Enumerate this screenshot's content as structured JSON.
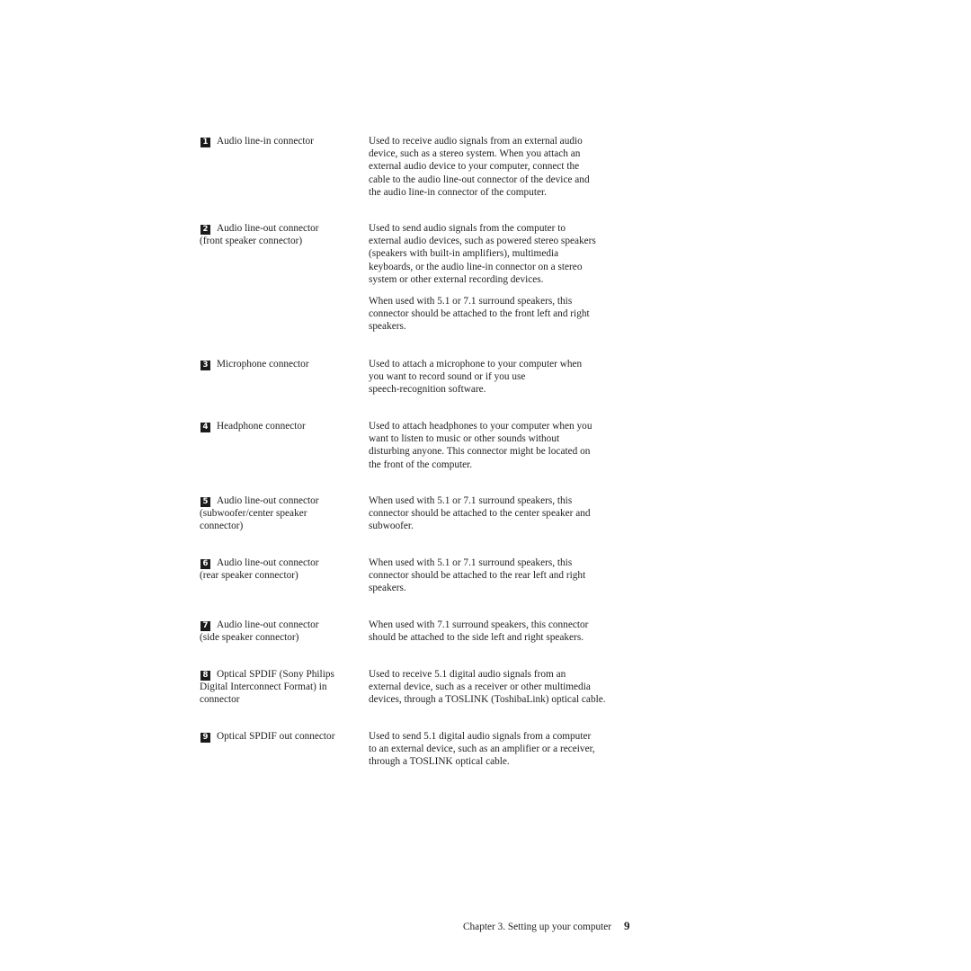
{
  "entries": [
    {
      "number": "1",
      "term": "Audio line-in connector",
      "description": [
        "Used to receive audio signals from an external audio\ndevice, such as a stereo system. When you attach an\nexternal audio device to your computer, connect the\ncable to the audio line-out connector of the device and\nthe audio line-in connector of the computer."
      ]
    },
    {
      "number": "2",
      "term": "Audio line-out connector\n(front speaker connector)",
      "description": [
        "Used to send audio signals from the computer to\nexternal audio devices, such as powered stereo speakers\n(speakers with built-in amplifiers), multimedia\nkeyboards, or the audio line-in connector on a stereo\nsystem or other external recording devices.",
        "When used with 5.1 or 7.1 surround speakers, this\nconnector should be attached to the front left and right\nspeakers."
      ]
    },
    {
      "number": "3",
      "term": "Microphone connector",
      "description": [
        "Used to attach a microphone to your computer when\nyou want to record sound or if you use\nspeech-recognition software."
      ]
    },
    {
      "number": "4",
      "term": "Headphone connector",
      "description": [
        "Used to attach headphones to your computer when you\nwant to listen to music or other sounds without\ndisturbing anyone. This connector might be located on\nthe front of the computer."
      ]
    },
    {
      "number": "5",
      "term": "Audio line-out connector\n(subwoofer/center speaker\nconnector)",
      "description": [
        "When used with 5.1 or 7.1 surround speakers, this\nconnector should be attached to the center speaker and\nsubwoofer."
      ]
    },
    {
      "number": "6",
      "term": "Audio line-out connector\n(rear speaker connector)",
      "description": [
        "When used with 5.1 or 7.1 surround speakers, this\nconnector should be attached to the rear left and right\nspeakers."
      ]
    },
    {
      "number": "7",
      "term": "Audio line-out connector\n(side speaker connector)",
      "description": [
        "When used with 7.1 surround speakers, this connector\nshould be attached to the side left and right speakers."
      ]
    },
    {
      "number": "8",
      "term": "Optical SPDIF (Sony Philips\nDigital Interconnect Format) in\nconnector",
      "description": [
        "Used to receive 5.1 digital audio signals from an\nexternal device, such as a receiver or other multimedia\ndevices, through a TOSLINK (ToshibaLink) optical cable."
      ]
    },
    {
      "number": "9",
      "term": "Optical SPDIF out connector",
      "description": [
        "Used to send 5.1 digital audio signals from a computer\nto an external device, such as an amplifier or a receiver,\nthrough a TOSLINK optical cable."
      ]
    }
  ],
  "footer": {
    "chapter": "Chapter 3. Setting up your computer",
    "page_number": "9"
  }
}
